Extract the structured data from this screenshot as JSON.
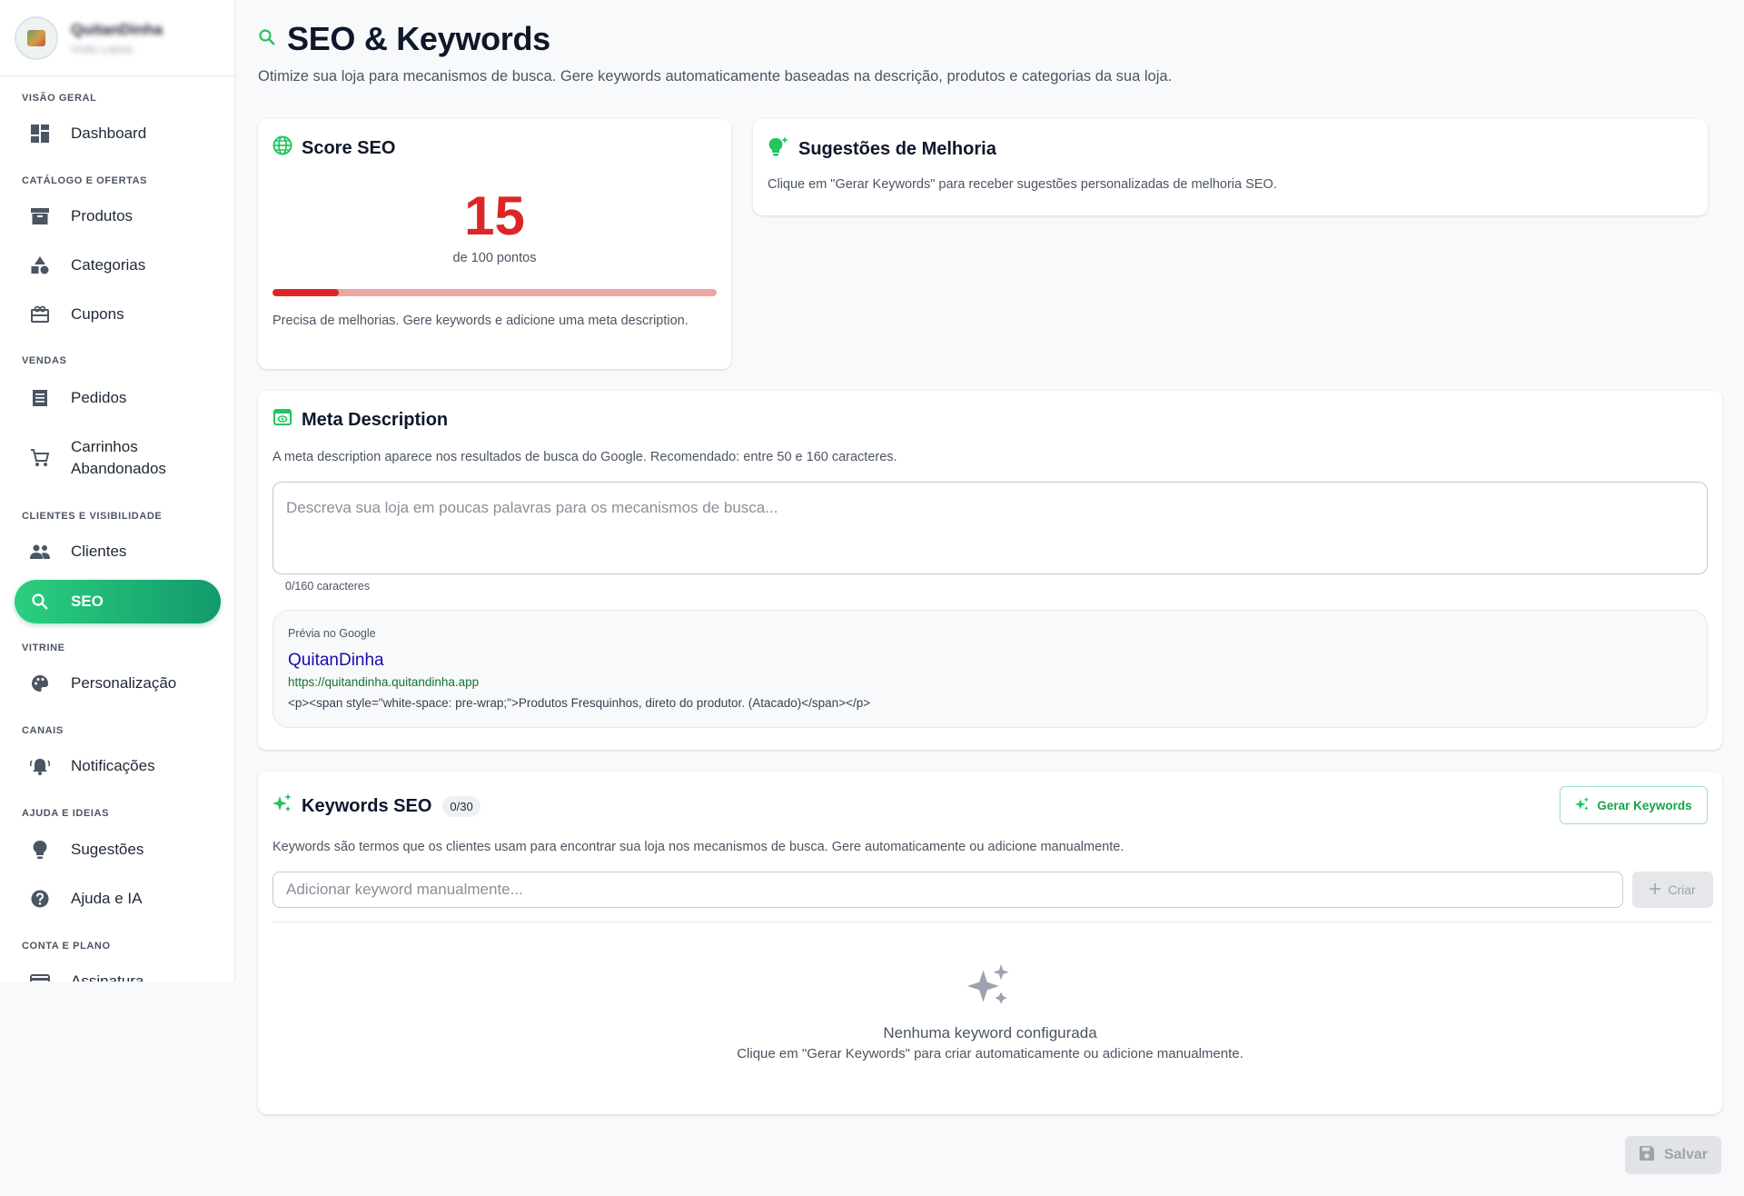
{
  "store": {
    "name": "QuitanDinha",
    "subtitle": "Visão Lojista"
  },
  "sidebar": {
    "sections": [
      "VISÃO GERAL",
      "CATÁLOGO E OFERTAS",
      "VENDAS",
      "CLIENTES E VISIBILIDADE",
      "VITRINE",
      "CANAIS",
      "AJUDA E IDEIAS",
      "CONTA E PLANO"
    ],
    "items": [
      {
        "label": "Dashboard",
        "icon": "dashboard-icon"
      },
      {
        "label": "Produtos",
        "icon": "archive-icon"
      },
      {
        "label": "Categorias",
        "icon": "category-icon"
      },
      {
        "label": "Cupons",
        "icon": "coupon-icon"
      },
      {
        "label": "Pedidos",
        "icon": "receipt-icon"
      },
      {
        "label": "Carrinhos Abandonados",
        "icon": "cart-icon"
      },
      {
        "label": "Clientes",
        "icon": "people-icon"
      },
      {
        "label": "SEO",
        "icon": "search-icon",
        "active": true
      },
      {
        "label": "Personalização",
        "icon": "palette-icon"
      },
      {
        "label": "Notificações",
        "icon": "bell-icon"
      },
      {
        "label": "Sugestões",
        "icon": "lightbulb-icon"
      },
      {
        "label": "Ajuda e IA",
        "icon": "help-icon"
      },
      {
        "label": "Assinatura",
        "icon": "credit-card-icon"
      }
    ]
  },
  "page": {
    "title": "SEO & Keywords",
    "subtitle": "Otimize sua loja para mecanismos de busca. Gere keywords automaticamente baseadas na descrição, produtos e categorias da sua loja."
  },
  "score": {
    "title": "Score SEO",
    "value": "15",
    "max_label": "de 100 pontos",
    "percent": 15,
    "message": "Precisa de melhorias. Gere keywords e adicione uma meta description."
  },
  "suggestions": {
    "title": "Sugestões de Melhoria",
    "text": "Clique em \"Gerar Keywords\" para receber sugestões personalizadas de melhoria SEO."
  },
  "meta": {
    "title": "Meta Description",
    "help": "A meta description aparece nos resultados de busca do Google. Recomendado: entre 50 e 160 caracteres.",
    "placeholder": "Descreva sua loja em poucas palavras para os mecanismos de busca...",
    "value": "",
    "char_count": "0/160 caracteres",
    "preview": {
      "label": "Prévia no Google",
      "title": "QuitanDinha",
      "url": "https://quitandinha.quitandinha.app",
      "description": "<p><span style=\"white-space: pre-wrap;\">Produtos Fresquinhos, direto do produtor. (Atacado)</span></p>"
    }
  },
  "keywords": {
    "title": "Keywords SEO",
    "count": "0/30",
    "generate_label": "Gerar Keywords",
    "help": "Keywords são termos que os clientes usam para encontrar sua loja nos mecanismos de busca. Gere automaticamente ou adicione manualmente.",
    "placeholder": "Adicionar keyword manualmente...",
    "create_label": "Criar",
    "empty_title": "Nenhuma keyword configurada",
    "empty_sub": "Clique em \"Gerar Keywords\" para criar automaticamente ou adicione manualmente."
  },
  "save_label": "Salvar",
  "colors": {
    "accent": "#22c55e",
    "accent_dark": "#129a6c",
    "score_red": "#dc2626",
    "link_blue": "#1a0dab",
    "url_green": "#137333"
  }
}
